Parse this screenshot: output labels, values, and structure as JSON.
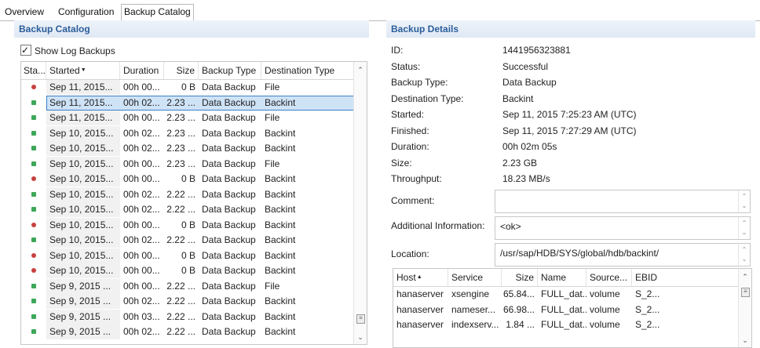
{
  "tabs": [
    {
      "label": "Overview"
    },
    {
      "label": "Configuration"
    },
    {
      "label": "Backup Catalog",
      "active": true
    }
  ],
  "catalog": {
    "title": "Backup Catalog",
    "show_log_label": "Show Log Backups",
    "show_log_checked": true,
    "columns": [
      "Sta...",
      "Started",
      "Duration",
      "Size",
      "Backup Type",
      "Destination Type"
    ],
    "sort_column": "Started",
    "rows": [
      {
        "status": "error",
        "started": "Sep 11, 2015...",
        "duration": "00h 00...",
        "size": "0 B",
        "type": "Data Backup",
        "dest": "File"
      },
      {
        "status": "ok",
        "started": "Sep 11, 2015...",
        "duration": "00h 02...",
        "size": "2.23 ...",
        "type": "Data Backup",
        "dest": "Backint",
        "selected": true
      },
      {
        "status": "ok",
        "started": "Sep 11, 2015...",
        "duration": "00h 00...",
        "size": "2.23 ...",
        "type": "Data Backup",
        "dest": "File"
      },
      {
        "status": "ok",
        "started": "Sep 10, 2015...",
        "duration": "00h 02...",
        "size": "2.23 ...",
        "type": "Data Backup",
        "dest": "Backint"
      },
      {
        "status": "ok",
        "started": "Sep 10, 2015...",
        "duration": "00h 02...",
        "size": "2.23 ...",
        "type": "Data Backup",
        "dest": "Backint"
      },
      {
        "status": "ok",
        "started": "Sep 10, 2015...",
        "duration": "00h 00...",
        "size": "2.23 ...",
        "type": "Data Backup",
        "dest": "File"
      },
      {
        "status": "error",
        "started": "Sep 10, 2015...",
        "duration": "00h 00...",
        "size": "0 B",
        "type": "Data Backup",
        "dest": "Backint"
      },
      {
        "status": "ok",
        "started": "Sep 10, 2015...",
        "duration": "00h 02...",
        "size": "2.22 ...",
        "type": "Data Backup",
        "dest": "Backint"
      },
      {
        "status": "ok",
        "started": "Sep 10, 2015...",
        "duration": "00h 02...",
        "size": "2.22 ...",
        "type": "Data Backup",
        "dest": "Backint"
      },
      {
        "status": "error",
        "started": "Sep 10, 2015...",
        "duration": "00h 00...",
        "size": "0 B",
        "type": "Data Backup",
        "dest": "Backint"
      },
      {
        "status": "ok",
        "started": "Sep 10, 2015...",
        "duration": "00h 02...",
        "size": "2.22 ...",
        "type": "Data Backup",
        "dest": "Backint"
      },
      {
        "status": "error",
        "started": "Sep 10, 2015...",
        "duration": "00h 00...",
        "size": "0 B",
        "type": "Data Backup",
        "dest": "Backint"
      },
      {
        "status": "error",
        "started": "Sep 10, 2015...",
        "duration": "00h 00...",
        "size": "0 B",
        "type": "Data Backup",
        "dest": "Backint"
      },
      {
        "status": "ok",
        "started": "Sep 9, 2015 ...",
        "duration": "00h 00...",
        "size": "2.22 ...",
        "type": "Data Backup",
        "dest": "File"
      },
      {
        "status": "ok",
        "started": "Sep 9, 2015 ...",
        "duration": "00h 02...",
        "size": "2.22 ...",
        "type": "Data Backup",
        "dest": "Backint"
      },
      {
        "status": "ok",
        "started": "Sep 9, 2015 ...",
        "duration": "00h 03...",
        "size": "2.22 ...",
        "type": "Data Backup",
        "dest": "Backint"
      },
      {
        "status": "ok",
        "started": "Sep 9, 2015 ...",
        "duration": "00h 02...",
        "size": "2.22 ...",
        "type": "Data Backup",
        "dest": "Backint"
      }
    ]
  },
  "details": {
    "title": "Backup Details",
    "fields": [
      {
        "label": "ID:",
        "value": "1441956323881"
      },
      {
        "label": "Status:",
        "value": "Successful"
      },
      {
        "label": "Backup Type:",
        "value": "Data Backup"
      },
      {
        "label": "Destination Type:",
        "value": "Backint"
      },
      {
        "label": "Started:",
        "value": "Sep 11, 2015 7:25:23 AM (UTC)"
      },
      {
        "label": "Finished:",
        "value": "Sep 11, 2015 7:27:29 AM (UTC)"
      },
      {
        "label": "Duration:",
        "value": "00h 02m 05s"
      },
      {
        "label": "Size:",
        "value": "2.23 GB"
      },
      {
        "label": "Throughput:",
        "value": "18.23 MB/s"
      }
    ],
    "comment_label": "Comment:",
    "comment_value": "",
    "additional_label": "Additional Information:",
    "additional_value": "<ok>",
    "location_label": "Location:",
    "location_value": "/usr/sap/HDB/SYS/global/hdb/backint/",
    "host_columns": [
      "Host",
      "Service",
      "Size",
      "Name",
      "Source...",
      "EBID"
    ],
    "host_sort_column": "Host",
    "hosts": [
      {
        "host": "hanaserver",
        "service": "xsengine",
        "size": "65.84...",
        "name": "FULL_dat...",
        "source": "volume",
        "ebid": "S_2..."
      },
      {
        "host": "hanaserver",
        "service": "nameser...",
        "size": "66.98...",
        "name": "FULL_dat...",
        "source": "volume",
        "ebid": "S_2..."
      },
      {
        "host": "hanaserver",
        "service": "indexserv...",
        "size": "1.84 ...",
        "name": "FULL_dat...",
        "source": "volume",
        "ebid": "S_2..."
      }
    ]
  },
  "colors": {
    "accent": "#2a5d9a",
    "selection": "#cfe3f7",
    "ok": "#3ea75a",
    "error": "#c94040"
  }
}
